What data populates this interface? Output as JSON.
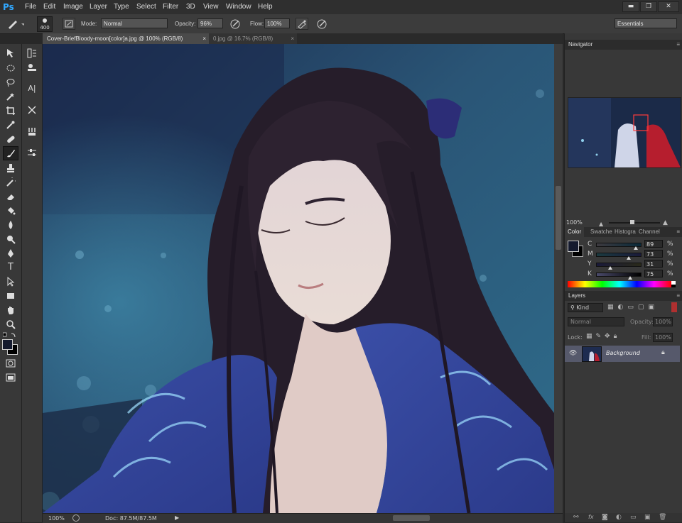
{
  "app": {
    "logo": "Ps",
    "accent": "#31a8ff"
  },
  "menu": [
    "File",
    "Edit",
    "Image",
    "Layer",
    "Type",
    "Select",
    "Filter",
    "3D",
    "View",
    "Window",
    "Help"
  ],
  "window_buttons": {
    "minimize": "▬",
    "restore": "❐",
    "close": "✕"
  },
  "options": {
    "brush_size": "400",
    "mode_label": "Mode:",
    "mode_value": "Normal",
    "opacity_label": "Opacity:",
    "opacity_value": "96%",
    "flow_label": "Flow:",
    "flow_value": "100%",
    "workspace": "Essentials"
  },
  "tabs": [
    {
      "label": "Cover-BriefBloody-moon[color]a.jpg @ 100% (RGB/8)",
      "close": "×"
    },
    {
      "label": "0.jpg @ 16.7% (RGB/8)",
      "close": "×"
    }
  ],
  "status": {
    "zoom": "100%",
    "doc": "Doc: 87.5M/87.5M"
  },
  "navigator": {
    "title": "Navigator",
    "zoom": "100%"
  },
  "color_panel": {
    "tabs": [
      "Color",
      "Swatche",
      "Histogra",
      "Channel"
    ],
    "channels": [
      {
        "name": "C",
        "value": "89",
        "unit": "%",
        "level": 0.89
      },
      {
        "name": "M",
        "value": "73",
        "unit": "%",
        "level": 0.73
      },
      {
        "name": "Y",
        "value": "31",
        "unit": "%",
        "level": 0.31
      },
      {
        "name": "K",
        "value": "75",
        "unit": "%",
        "level": 0.75
      }
    ],
    "foreground": "#141a2e",
    "background": "#000000"
  },
  "layers": {
    "title": "Layers",
    "kind_label": "Kind",
    "blend_mode": "Normal",
    "opacity_label": "Opacity:",
    "opacity_value": "100%",
    "lock_label": "Lock:",
    "fill_label": "Fill:",
    "fill_value": "100%",
    "items": [
      {
        "name": "Background"
      }
    ]
  }
}
